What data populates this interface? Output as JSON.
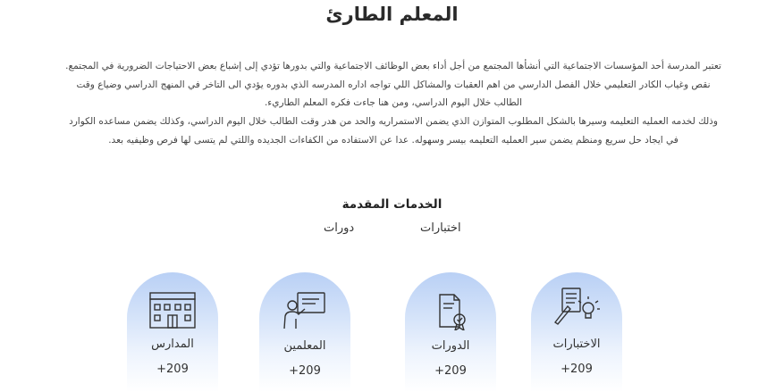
{
  "page": {
    "title": "المعلم الطارئ"
  },
  "intro": {
    "lines": [
      "تعتبر المدرسة أحد المؤسسات الاجتماعية التي أنشأها المجتمع من أجل أداء بعض الوظائف الاجتماعية والتي بدورها تؤدي إلى إشباع بعض الاحتياجات الضرورية في المجتمع.",
      "نقص وغياب الكادر التعليمي خلال الفصل الدارسي من اهم العقبات والمشاكل اللي تواجه اداره المدرسه  الذي بدوره يؤدي الى التاخر في المنهج الدراسي وضياع وقت",
      "الطالب خلال اليوم الدراسي، ومن هنا جاءت فكره المعلم الطاريء.",
      "وذلك لخدمه العمليه التعليمه وسيرها بالشكل المطلوب المتوازن الذي يضمن الاستمراريه والحد من هدر وقت الطالب خلال اليوم الدراسي، وكذلك  يضمن مساعده الكوارد",
      "في ايجاد حل سريع ومنظم  يضمن سير العمليه التعليمه بيسر وسهوله. عدا عن  الاستفاده من الكفاءات   الجديده واللتي لم  يتسى لها فرص وظيفيه بعد."
    ]
  },
  "services": {
    "title": "الخدمات المقدمة",
    "links": [
      "اختبارات",
      "دورات"
    ]
  },
  "cards": [
    {
      "label": "الاختبارات",
      "count": "+209",
      "icon": "exam-idea-icon"
    },
    {
      "label": "الدورات",
      "count": "+209",
      "icon": "certificate-document-icon"
    },
    {
      "label": "المعلمين",
      "count": "+209",
      "icon": "teacher-board-icon"
    },
    {
      "label": "المدارس",
      "count": "+209",
      "icon": "school-building-icon"
    }
  ],
  "colors": {
    "card_gradient_top": "#b9d0f5",
    "icon_stroke": "#333333"
  }
}
